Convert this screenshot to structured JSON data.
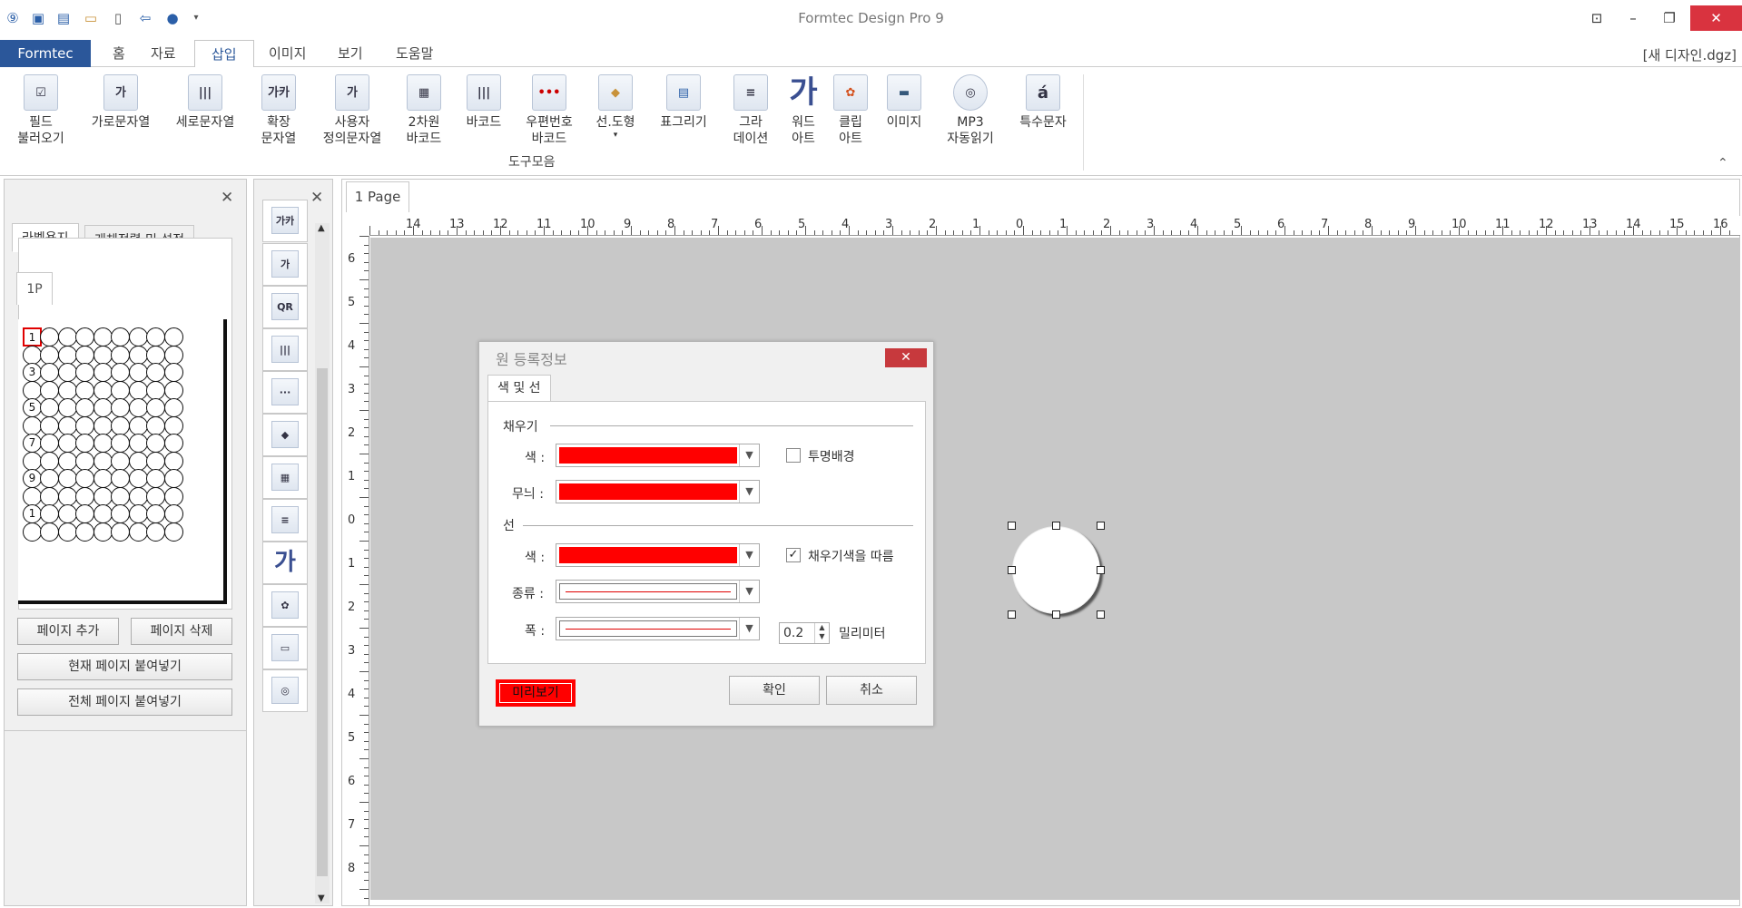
{
  "app": {
    "title": "Formtec Design Pro 9",
    "file_name": "[새 디자인.dgz]"
  },
  "ribbon_tabs": [
    {
      "label": "Formtec"
    },
    {
      "label": "홈"
    },
    {
      "label": "자료"
    },
    {
      "label": "삽입"
    },
    {
      "label": "이미지"
    },
    {
      "label": "보기"
    },
    {
      "label": "도움말"
    }
  ],
  "ribbon": {
    "buttons": [
      {
        "label": "필드\n불러오기",
        "icon": "field-load-icon"
      },
      {
        "label": "가로문자열",
        "icon": "horizontal-text-icon"
      },
      {
        "label": "세로문자열",
        "icon": "vertical-text-icon"
      },
      {
        "label": "확장\n문자열",
        "icon": "extended-text-icon"
      },
      {
        "label": "사용자\n정의문자열",
        "icon": "custom-text-icon"
      },
      {
        "label": "2차원\n바코드",
        "icon": "qr-code-icon"
      },
      {
        "label": "바코드",
        "icon": "barcode-icon"
      },
      {
        "label": "우편번호\n바코드",
        "icon": "postal-barcode-icon"
      },
      {
        "label": "선.도형",
        "icon": "shape-icon"
      },
      {
        "label": "표그리기",
        "icon": "table-icon"
      },
      {
        "label": "그라\n데이션",
        "icon": "gradient-icon"
      },
      {
        "label": "워드\n아트",
        "icon": "wordart-icon"
      },
      {
        "label": "클립\n아트",
        "icon": "clipart-icon"
      },
      {
        "label": "이미지",
        "icon": "image-icon"
      },
      {
        "label": "MP3\n자동읽기",
        "icon": "mp3-icon"
      },
      {
        "label": "특수문자",
        "icon": "special-char-icon"
      }
    ],
    "group_label": "도구모음",
    "wordart_glyph": "가",
    "special_glyph": "á"
  },
  "left_panel": {
    "tabs": [
      "라벨용지",
      "개체정렬 및 설정"
    ],
    "page_tab": "1P",
    "label_numbers": [
      "1",
      "3",
      "5",
      "7",
      "9",
      "1",
      "1"
    ],
    "buttons": {
      "add_page": "페이지 추가",
      "delete_page": "페이지 삭제",
      "paste_current": "현재 페이지 붙여넣기",
      "paste_all": "전체 페이지 붙여넣기"
    }
  },
  "toolbox": {
    "tools": [
      "가카",
      "가",
      "QR",
      "|||",
      "···",
      "◆",
      "▦",
      "≡",
      "가",
      "✿",
      "▭",
      "◎"
    ]
  },
  "document": {
    "page_tab": "1 Page",
    "h_ruler": [
      "14",
      "13",
      "12",
      "11",
      "10",
      "9",
      "8",
      "7",
      "6",
      "5",
      "4",
      "3",
      "2",
      "1",
      "0",
      "1",
      "2",
      "3",
      "4",
      "5",
      "6",
      "7",
      "8",
      "9",
      "10",
      "11",
      "12",
      "13",
      "14",
      "15",
      "16"
    ],
    "v_ruler": [
      "6",
      "5",
      "4",
      "3",
      "2",
      "1",
      "0",
      "1",
      "2",
      "3",
      "4",
      "5",
      "6",
      "7",
      "8"
    ]
  },
  "dialog": {
    "title": "원 등록정보",
    "tab": "색 및 선",
    "fill_section": "채우기",
    "line_section": "선",
    "fill_color_label": "색 :",
    "pattern_label": "무늬 :",
    "line_color_label": "색 :",
    "type_label": "종류 :",
    "width_label": "폭 :",
    "transparent_label": "투명배경",
    "follow_fill_label": "채우기색을 따름",
    "transparent_checked": false,
    "follow_fill_checked": true,
    "width_value": "0.2",
    "width_unit": "밀리미터",
    "preview_label": "미리보기",
    "ok_label": "확인",
    "cancel_label": "취소",
    "fill_color": "#ff0000",
    "pattern_color": "#ff0000",
    "line_color": "#ff0000"
  },
  "colors": {
    "file_tab": "#2b579a",
    "close_button": "#d9333f",
    "canvas": "#c8c8c8"
  }
}
